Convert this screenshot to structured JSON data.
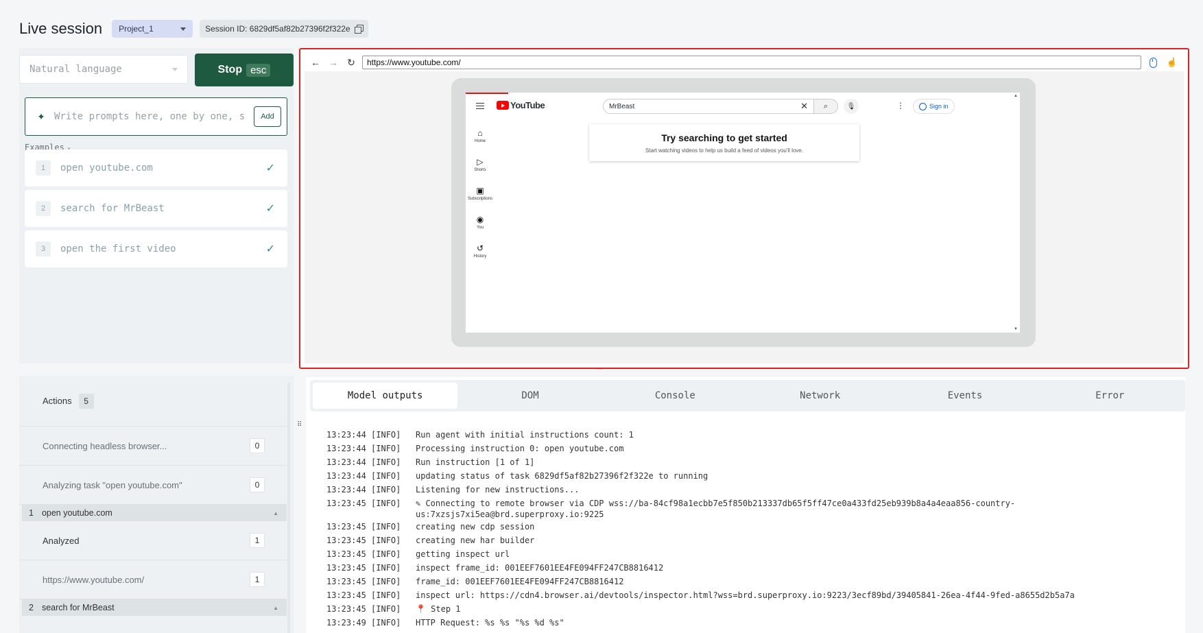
{
  "header": {
    "title": "Live session",
    "project": "Project_1",
    "session_label": "Session ID: 6829df5af82b27396f2f322e"
  },
  "controls": {
    "language_placeholder": "Natural language",
    "stop_label": "Stop",
    "stop_key": "esc",
    "prompt_placeholder": "Write prompts here, one by one, s",
    "add_label": "Add",
    "examples_label": "Examples"
  },
  "examples": [
    {
      "num": "1",
      "text": "open youtube.com"
    },
    {
      "num": "2",
      "text": "search for MrBeast"
    },
    {
      "num": "3",
      "text": "open the first video"
    }
  ],
  "browser": {
    "url": "https://www.youtube.com/",
    "yt_logo_text": "YouTube",
    "search_value": "MrBeast",
    "sign_in": "Sign in",
    "sidebar": [
      "Home",
      "Shorts",
      "Subscriptions",
      "You",
      "History"
    ],
    "card_title": "Try searching to get started",
    "card_subtitle": "Start watching videos to help us build a feed of videos you'll love."
  },
  "actions": {
    "label": "Actions",
    "count": "5",
    "rows": [
      {
        "text": "Connecting headless browser...",
        "count": "0"
      },
      {
        "text": "Analyzing task \"open youtube.com\"",
        "count": "0"
      }
    ],
    "group1": {
      "num": "1",
      "text": "open youtube.com"
    },
    "group1_rows": [
      {
        "text": "Analyzed",
        "count": "1"
      },
      {
        "text": "https://www.youtube.com/",
        "count": "1"
      }
    ],
    "group2": {
      "num": "2",
      "text": "search for MrBeast"
    }
  },
  "tabs": [
    "Model outputs",
    "DOM",
    "Console",
    "Network",
    "Events",
    "Error"
  ],
  "log": [
    {
      "t": "13:23:44 [INFO]",
      "m": "Run agent with initial instructions count: 1"
    },
    {
      "t": "13:23:44 [INFO]",
      "m": "Processing instruction 0: open youtube.com"
    },
    {
      "t": "13:23:44 [INFO]",
      "m": "Run instruction [1 of 1]"
    },
    {
      "t": "13:23:44 [INFO]",
      "m": "updating status of task 6829df5af82b27396f2f322e to running"
    },
    {
      "t": "13:23:44 [INFO]",
      "m": "Listening for new instructions..."
    },
    {
      "t": "13:23:45 [INFO]",
      "m": "✎ Connecting to remote browser via CDP wss://ba-84cf98a1ecbb7e5f850b213337db65f5ff47ce0a433fd25eb939b8a4a4eaa856-country-us:7xzsjs7xi5ea@brd.superproxy.io:9225"
    },
    {
      "t": "13:23:45 [INFO]",
      "m": "creating new cdp session"
    },
    {
      "t": "13:23:45 [INFO]",
      "m": "creating new har builder"
    },
    {
      "t": "13:23:45 [INFO]",
      "m": "getting inspect url"
    },
    {
      "t": "13:23:45 [INFO]",
      "m": "inspect frame_id: 001EEF7601EE4FE094FF247CB8816412"
    },
    {
      "t": "13:23:45 [INFO]",
      "m": "frame_id: 001EEF7601EE4FE094FF247CB8816412"
    },
    {
      "t": "13:23:45 [INFO]",
      "m": "inspect url: https://cdn4.browser.ai/devtools/inspector.html?wss=brd.superproxy.io:9223/3ecf89bd/39405841-26ea-4f44-9fed-a8655d2b5a7a"
    },
    {
      "t": "13:23:45 [INFO]",
      "m": "📍 Step 1"
    },
    {
      "t": "13:23:49 [INFO]",
      "m": "HTTP Request: %s %s \"%s %d %s\""
    }
  ]
}
